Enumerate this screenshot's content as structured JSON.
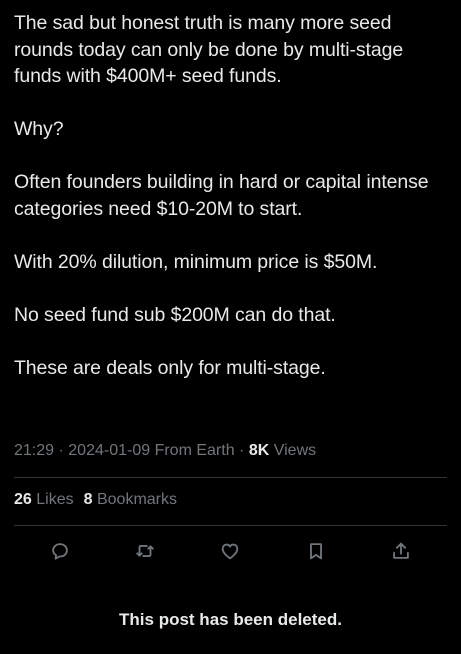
{
  "post": {
    "paragraphs": [
      "The sad but honest truth is many more seed rounds today can only be done by multi-stage funds with $400M+ seed funds.",
      "Why?",
      "Often founders building in hard or capital intense categories need $10-20M to start.",
      "With 20% dilution, minimum price is $50M.",
      "No seed fund sub $200M can do that.",
      "These are deals only for multi-stage."
    ],
    "time": "21:29",
    "separator": "·",
    "date": "2024-01-09",
    "source": "From Earth",
    "views_count": "8K",
    "views_label": "Views"
  },
  "stats": {
    "likes_count": "26",
    "likes_label": "Likes",
    "bookmarks_count": "8",
    "bookmarks_label": "Bookmarks"
  },
  "actions": {
    "icons": [
      "reply-icon",
      "repost-icon",
      "like-icon",
      "bookmark-icon",
      "share-icon"
    ],
    "icon_color": "#71767b"
  },
  "notice": {
    "text": "This post has been deleted."
  },
  "colors": {
    "background": "#000000",
    "primary_text": "#e7e9ea",
    "secondary_text": "#71767b",
    "divider": "#2f3336"
  }
}
